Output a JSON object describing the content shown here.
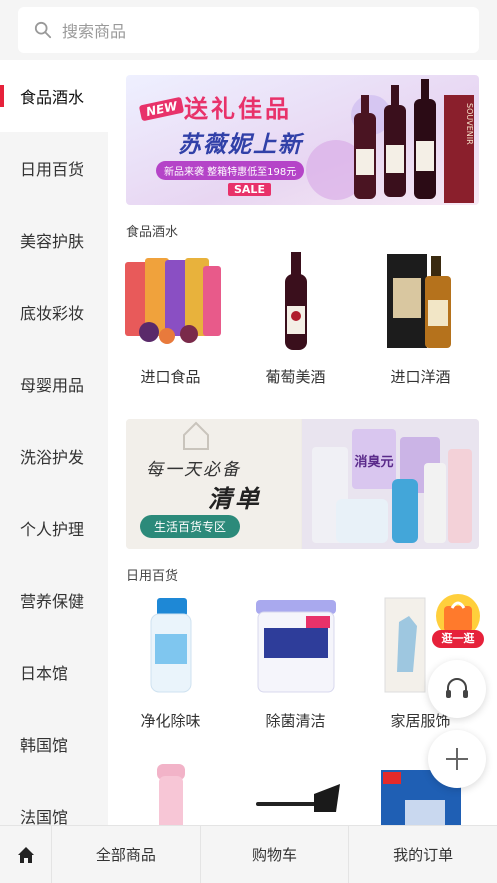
{
  "search": {
    "placeholder": "搜索商品"
  },
  "sidebar": {
    "items": [
      {
        "label": "食品酒水"
      },
      {
        "label": "日用百货"
      },
      {
        "label": "美容护肤"
      },
      {
        "label": "底妆彩妆"
      },
      {
        "label": "母婴用品"
      },
      {
        "label": "洗浴护发"
      },
      {
        "label": "个人护理"
      },
      {
        "label": "营养保健"
      },
      {
        "label": "日本馆"
      },
      {
        "label": "韩国馆"
      },
      {
        "label": "法国馆"
      }
    ],
    "active_index": 0
  },
  "banner1": {
    "badge": "NEW",
    "headline": "送礼佳品",
    "subline": "苏薇妮上新",
    "promo": "新品来袭 整箱特惠低至198元",
    "tag": "SALE",
    "brand": "SOUVENIR"
  },
  "section1": {
    "title": "食品酒水",
    "items": [
      {
        "label": "进口食品"
      },
      {
        "label": "葡萄美酒"
      },
      {
        "label": "进口洋酒"
      }
    ]
  },
  "banner2": {
    "line1": "每一天必备",
    "line2": "清单",
    "pill": "生活百货专区",
    "product_text": "消臭元"
  },
  "section2": {
    "title": "日用百货",
    "items": [
      {
        "label": "净化除味"
      },
      {
        "label": "除菌清洁"
      },
      {
        "label": "家居服饰"
      }
    ]
  },
  "float": {
    "promo_label": "逛一逛"
  },
  "bottom_nav": {
    "tabs": [
      {
        "label": "全部商品"
      },
      {
        "label": "购物车"
      },
      {
        "label": "我的订单"
      }
    ]
  },
  "colors": {
    "accent": "#e6213a",
    "bg": "#f5f5f5"
  }
}
